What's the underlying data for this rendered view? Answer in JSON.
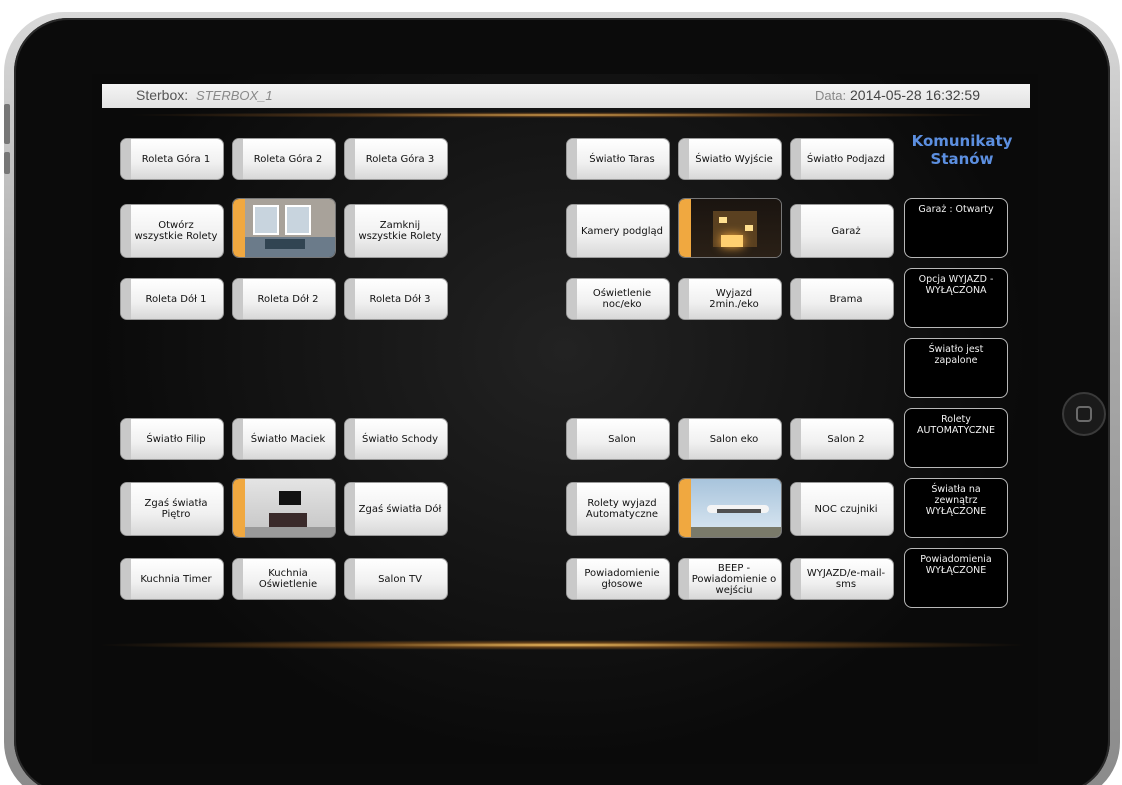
{
  "header": {
    "label": "Sterbox:",
    "app_name": "STERBOX_1",
    "date_label": "Data:",
    "date_value": "2014-05-28 16:32:59"
  },
  "left_group": {
    "roleta_gora_1": "Roleta Góra 1",
    "roleta_gora_2": "Roleta Góra 2",
    "roleta_gora_3": "Roleta Góra 3",
    "otworz_rolety": "Otwórz wszystkie Rolety",
    "zamknij_rolety": "Zamknij wszystkie Rolety",
    "roleta_dol_1": "Roleta Dół 1",
    "roleta_dol_2": "Roleta Dół 2",
    "roleta_dol_3": "Roleta Dół 3",
    "swiatlo_filip": "Światło Filip",
    "swiatlo_maciek": "Światło Maciek",
    "swiatlo_schody": "Światło Schody",
    "zgas_pietro": "Zgaś światła Piętro",
    "zgas_dol": "Zgaś światła Dół",
    "kuchnia_timer": "Kuchnia Timer",
    "kuchnia_oswietlenie": "Kuchnia Oświetlenie",
    "salon_tv": "Salon TV"
  },
  "right_group": {
    "swiatlo_taras": "Światło Taras",
    "swiatlo_wyjscie": "Światło Wyjście",
    "swiatlo_podjazd": "Światło Podjazd",
    "kamery": "Kamery podgląd",
    "garaz": "Garaż",
    "oswietlenie_noc": "Oświetlenie noc/eko",
    "wyjazd_2min": "Wyjazd 2min./eko",
    "brama": "Brama",
    "salon": "Salon",
    "salon_eko": "Salon eko",
    "salon_2": "Salon 2",
    "rolety_wyjazd": "Rolety wyjazd Automatyczne",
    "noc_czujniki": "NOC czujniki",
    "powiadomienie_glosowe": "Powiadomienie głosowe",
    "beep": "BEEP - Powiadomienie o wejściu",
    "wyjazd_email": "WYJAZD/e-mail-sms"
  },
  "status": {
    "title": "Komunikaty Stanów",
    "messages": [
      "Garaż : Otwarty",
      "Opcja WYJAZD - WYŁĄCZONA",
      "Światło jest zapalone",
      "Rolety AUTOMATYCZNE",
      "Światła na zewnątrz WYŁĄCZONE",
      "Powiadomienia WYŁĄCZONE"
    ]
  },
  "colors": {
    "accent_orange": "#f0a840",
    "status_title_blue": "#5c8fe0"
  },
  "icons": {
    "home_button": "home-button-icon"
  }
}
